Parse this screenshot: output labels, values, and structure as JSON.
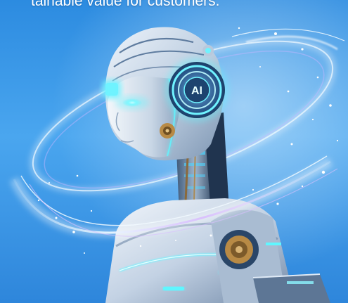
{
  "caption": {
    "text": "tainable value for customers."
  },
  "badge": {
    "text": "AI"
  },
  "colors": {
    "sky_light": "#5cb6f4",
    "sky_dark": "#1e78d4",
    "glow": "#5ff6ff",
    "robot_body": "#d7e3f2",
    "robot_shadow": "#6e8aa8",
    "bronze": "#b88a45"
  }
}
